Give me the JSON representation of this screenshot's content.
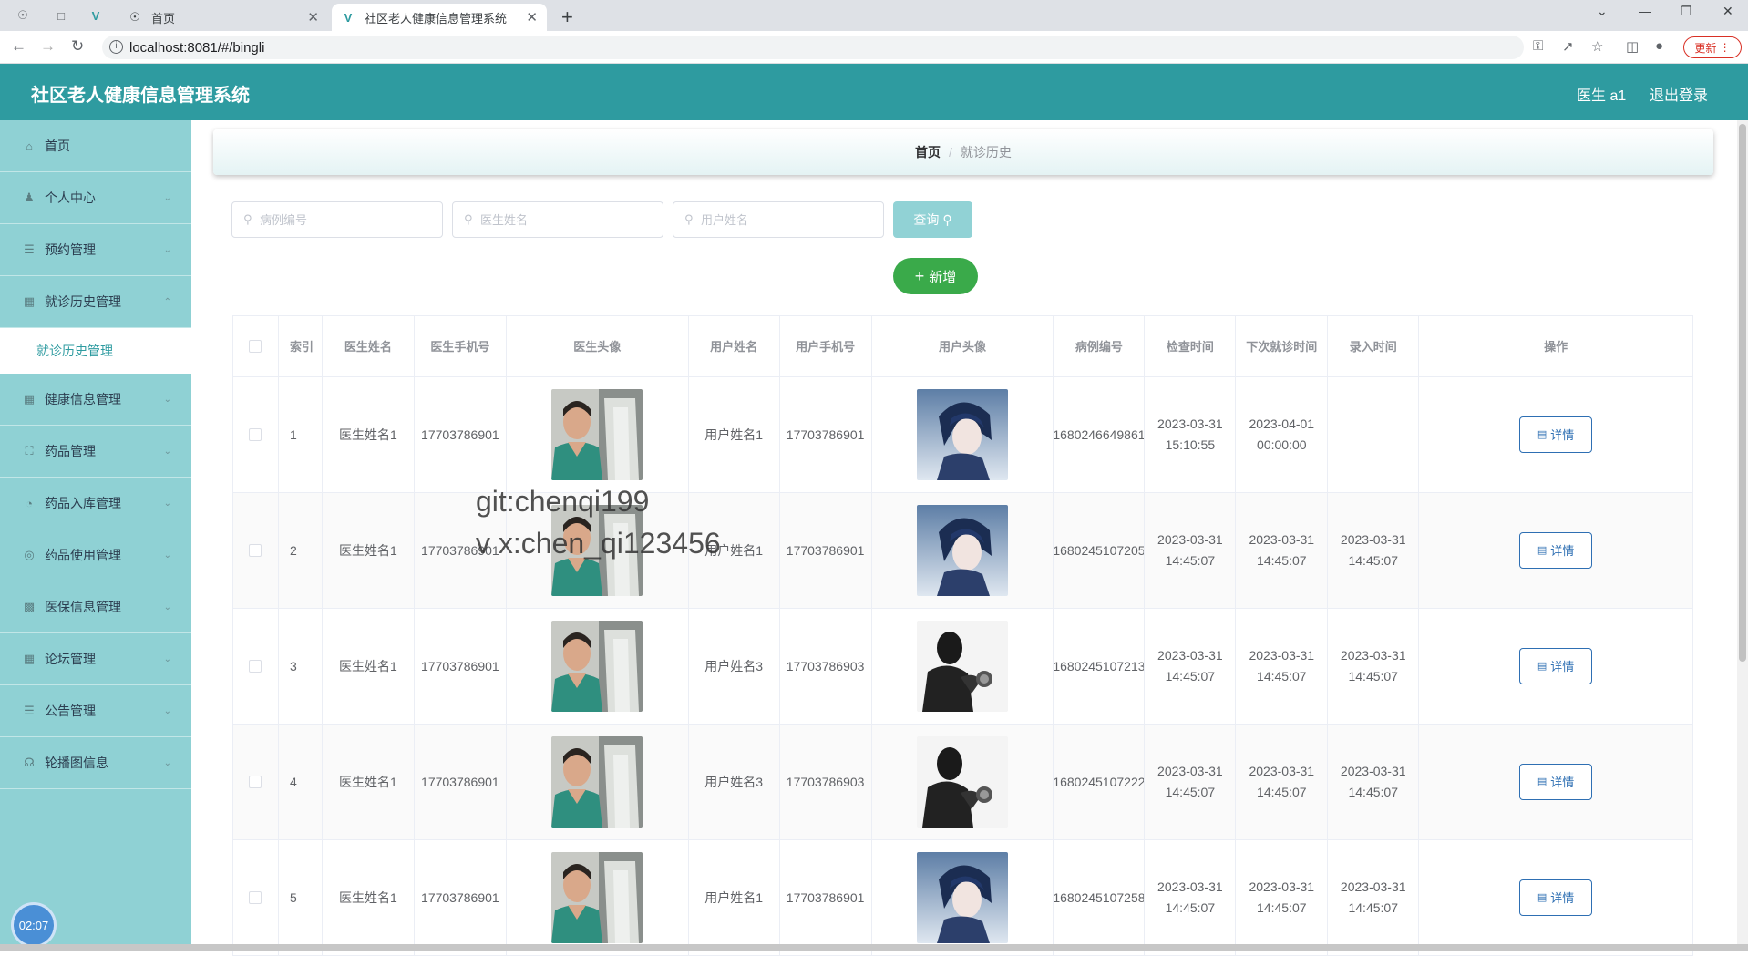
{
  "browser": {
    "tabs": [
      {
        "title": "首页",
        "active": false
      },
      {
        "title": "社区老人健康信息管理系统",
        "active": true
      }
    ],
    "url": "localhost:8081/#/bingli",
    "update_label": "更新"
  },
  "header": {
    "title": "社区老人健康信息管理系统",
    "user": "医生 a1",
    "logout": "退出登录"
  },
  "sidebar": {
    "items": [
      {
        "label": "首页",
        "icon": "home-icon"
      },
      {
        "label": "个人中心",
        "icon": "user-icon"
      },
      {
        "label": "预约管理",
        "icon": "list-icon"
      },
      {
        "label": "就诊历史管理",
        "icon": "record-icon"
      },
      {
        "label": "健康信息管理",
        "icon": "record-icon"
      },
      {
        "label": "药品管理",
        "icon": "frame-icon"
      },
      {
        "label": "药品入库管理",
        "icon": "gauge-icon"
      },
      {
        "label": "药品使用管理",
        "icon": "target-icon"
      },
      {
        "label": "医保信息管理",
        "icon": "chat-icon"
      },
      {
        "label": "论坛管理",
        "icon": "grid-icon"
      },
      {
        "label": "公告管理",
        "icon": "sliders-icon"
      },
      {
        "label": "轮播图信息",
        "icon": "mic-icon"
      }
    ],
    "submenu": {
      "label": "就诊历史管理"
    },
    "clock": "02:07"
  },
  "breadcrumb": {
    "home": "首页",
    "current": "就诊历史"
  },
  "search": {
    "case_placeholder": "病例编号",
    "doctor_placeholder": "医生姓名",
    "user_placeholder": "用户姓名",
    "query_label": "查询",
    "add_label": "新增"
  },
  "table": {
    "headers": {
      "index": "索引",
      "doctor_name": "医生姓名",
      "doctor_phone": "医生手机号",
      "doctor_avatar": "医生头像",
      "user_name": "用户姓名",
      "user_phone": "用户手机号",
      "user_avatar": "用户头像",
      "case_no": "病例编号",
      "check_time": "检查时间",
      "next_time": "下次就诊时间",
      "entry_time": "录入时间",
      "ops": "操作"
    },
    "detail_label": "详情",
    "rows": [
      {
        "index": "1",
        "doctor_name": "医生姓名1",
        "doctor_phone": "17703786901",
        "user_name": "用户姓名1",
        "user_phone": "17703786901",
        "user_avatar": "boy",
        "case_no": "1680246649861",
        "check_time": "2023-03-31 15:10:55",
        "next_time": "2023-04-01 00:00:00",
        "entry_time": ""
      },
      {
        "index": "2",
        "doctor_name": "医生姓名1",
        "doctor_phone": "17703786901",
        "user_name": "用户姓名1",
        "user_phone": "17703786901",
        "user_avatar": "boy",
        "case_no": "1680245107205",
        "check_time": "2023-03-31 14:45:07",
        "next_time": "2023-03-31 14:45:07",
        "entry_time": "2023-03-31 14:45:07"
      },
      {
        "index": "3",
        "doctor_name": "医生姓名1",
        "doctor_phone": "17703786901",
        "user_name": "用户姓名3",
        "user_phone": "17703786903",
        "user_avatar": "silhouette",
        "case_no": "1680245107213",
        "check_time": "2023-03-31 14:45:07",
        "next_time": "2023-03-31 14:45:07",
        "entry_time": "2023-03-31 14:45:07"
      },
      {
        "index": "4",
        "doctor_name": "医生姓名1",
        "doctor_phone": "17703786901",
        "user_name": "用户姓名3",
        "user_phone": "17703786903",
        "user_avatar": "silhouette",
        "case_no": "1680245107222",
        "check_time": "2023-03-31 14:45:07",
        "next_time": "2023-03-31 14:45:07",
        "entry_time": "2023-03-31 14:45:07"
      },
      {
        "index": "5",
        "doctor_name": "医生姓名1",
        "doctor_phone": "17703786901",
        "user_name": "用户姓名1",
        "user_phone": "17703786901",
        "user_avatar": "boy",
        "case_no": "1680245107258",
        "check_time": "2023-03-31 14:45:07",
        "next_time": "2023-03-31 14:45:07",
        "entry_time": "2023-03-31 14:45:07"
      }
    ]
  },
  "watermark": {
    "line1": "git:chenqi199",
    "line2": "v x:chen_qi123456"
  },
  "colors": {
    "header": "#2e9ba0",
    "sidebar": "#8fd1d4",
    "add_button": "#3aaa4a",
    "detail_button": "#2e6fb3"
  }
}
